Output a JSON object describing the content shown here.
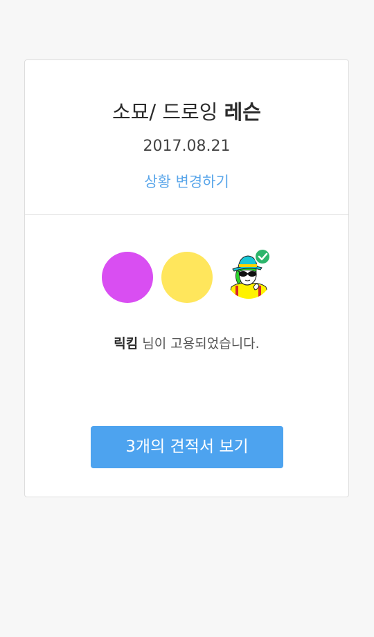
{
  "card": {
    "title_regular": "소묘/ 드로잉 ",
    "title_bold": "레슨",
    "date": "2017.08.21",
    "change_status_link": "상황 변경하기"
  },
  "avatars": [
    {
      "color": "#d94ef2",
      "icon": "avatar-placeholder"
    },
    {
      "color": "#ffe65c",
      "icon": "avatar-placeholder"
    },
    {
      "icon": "hired-expert-avatar",
      "badge": "verified-check-icon"
    }
  ],
  "hired": {
    "name": "릭킴",
    "message": " 님이 고용되었습니다."
  },
  "quotes_button": {
    "label": "3개의 견적서 보기"
  },
  "colors": {
    "accent": "#4da3ef",
    "link": "#5aa6ea",
    "badge": "#2db56b"
  }
}
